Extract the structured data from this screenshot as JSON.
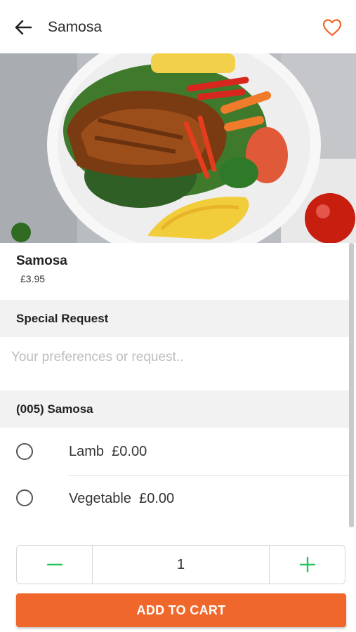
{
  "header": {
    "title": "Samosa",
    "back_icon": "arrow-left-icon",
    "favorite_icon": "heart-outline-icon",
    "favorite_color": "#f0672b"
  },
  "hero": {
    "image": "food-plate-photo"
  },
  "item": {
    "name": "Samosa",
    "price": "£3.95"
  },
  "special_request": {
    "heading": "Special Request",
    "placeholder": "Your preferences or request.."
  },
  "options_group": {
    "heading": "(005) Samosa",
    "options": [
      {
        "name": "Lamb",
        "price": "£0.00"
      },
      {
        "name": "Vegetable",
        "price": "£0.00"
      }
    ]
  },
  "quantity": {
    "value": "1",
    "minus_icon": "minus-icon",
    "plus_icon": "plus-icon",
    "icon_color": "#22c55e"
  },
  "cart_button": {
    "label": "ADD TO CART",
    "color": "#f0672b"
  }
}
